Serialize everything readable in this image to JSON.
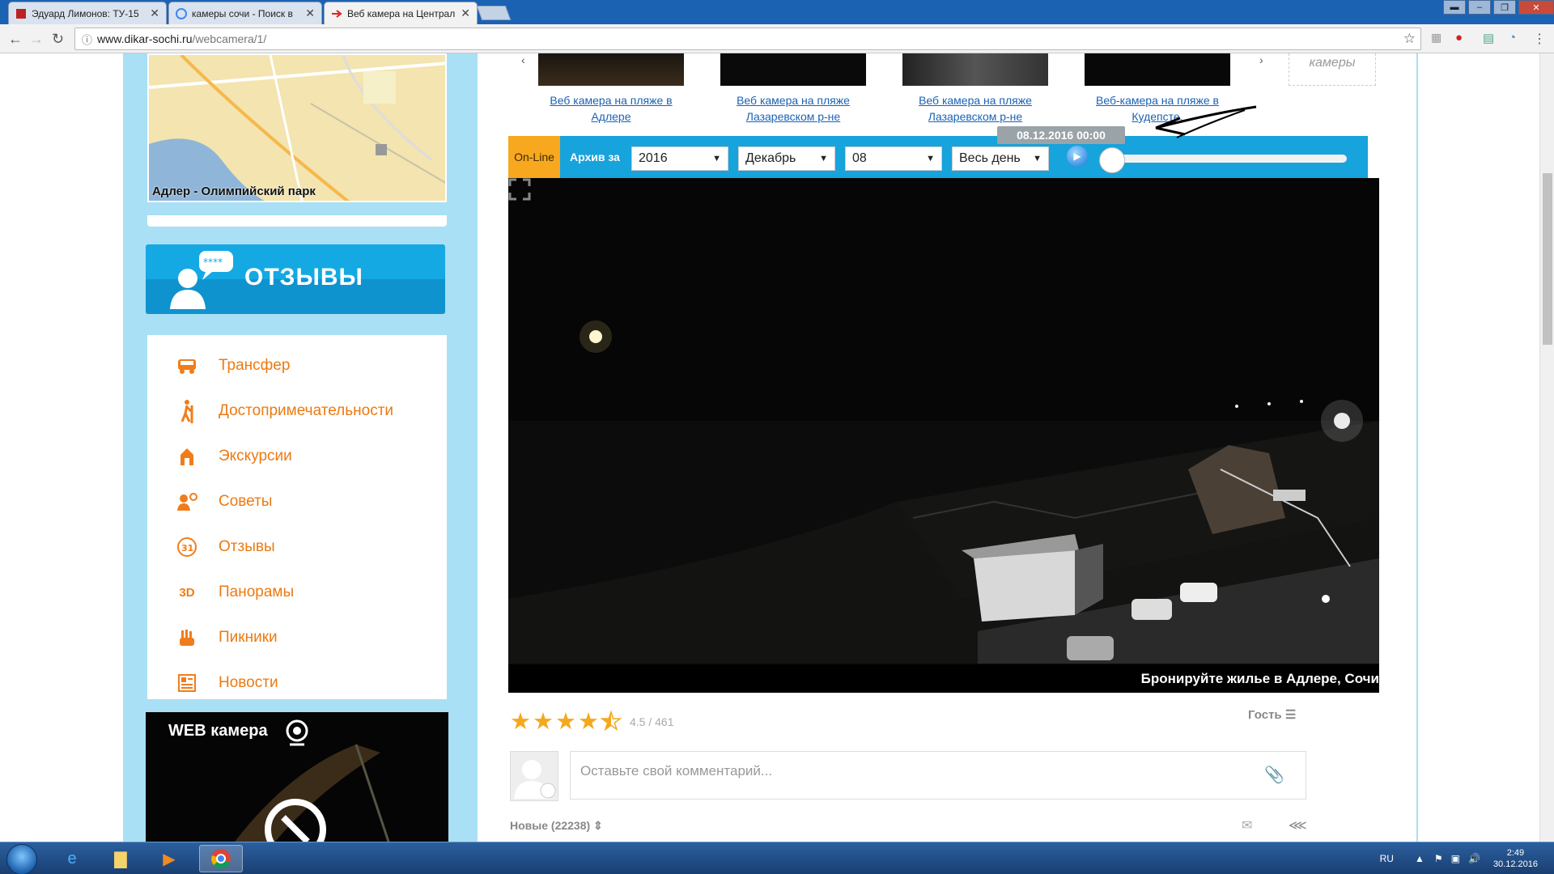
{
  "browser": {
    "tabs": [
      {
        "title": "Эдуард Лимонов: ТУ-15",
        "icon": "page-icon"
      },
      {
        "title": "камеры сочи - Поиск в",
        "icon": "google-icon"
      },
      {
        "title": "Веб камера на Централ",
        "icon": "arrow-icon"
      }
    ],
    "url_host": "www.dikar-sochi.ru",
    "url_path": "/webcamera/1/"
  },
  "sidebar": {
    "map_label": "Адлер - Олимпийский парк",
    "reviews_button": "ОТЗЫВЫ",
    "menu": [
      {
        "label": "Трансфер",
        "icon": "bus-icon"
      },
      {
        "label": "Достопримечательности",
        "icon": "hiker-icon"
      },
      {
        "label": "Экскурсии",
        "icon": "landmark-icon"
      },
      {
        "label": "Советы",
        "icon": "advice-icon"
      },
      {
        "label": "Отзывы",
        "icon": "calendar-31-icon"
      },
      {
        "label": "Панорамы",
        "icon": "3d-icon",
        "glyph": "3D"
      },
      {
        "label": "Пикники",
        "icon": "hand-icon"
      },
      {
        "label": "Новости",
        "icon": "news-icon"
      }
    ],
    "webcam_title": "WEB камера"
  },
  "thumbs": [
    "Веб камера на пляже в Адлере",
    "Веб камера на пляже Лазаревском р-не",
    "Веб камера на пляже Лазаревском р-не",
    "Веб-камера на пляже в Кудепсте."
  ],
  "cams_box": "камеры",
  "player": {
    "online": "On-Line",
    "archive_label": "Архив за",
    "year": "2016",
    "month": "Декабрь",
    "day": "08",
    "period": "Весь день",
    "timestamp": "08.12.2016 00:00",
    "caption": "Бронируйте жилье в Адлере, Сочи"
  },
  "rating": {
    "value": "4.5 / 461",
    "stars": 4.5
  },
  "guest": "Гость",
  "comment_placeholder": "Оставьте свой комментарий...",
  "sort_label": "Новые (22238)",
  "taskbar": {
    "lang": "RU",
    "time": "2:49",
    "date": "30.12.2016"
  },
  "colors": {
    "accent_orange": "#ec7a12",
    "bar_blue": "#17a3dc",
    "link_blue": "#1a63b7",
    "star": "#f5a81d"
  }
}
